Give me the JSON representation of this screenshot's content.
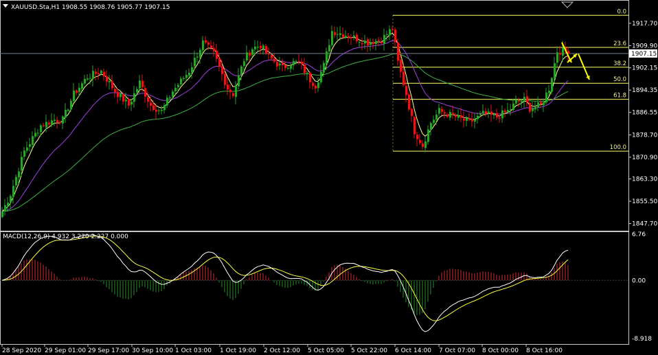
{
  "header": {
    "symbol": "XAUUSD.Sta,H1",
    "ohlc": "1908.55 1908.76 1905.77 1907.15"
  },
  "macd": {
    "label": "MACD(12,26,9) 4.932 3.220 2.227 0.000",
    "axis_ticks": [
      "6.76",
      "0.00",
      "-8.918"
    ]
  },
  "price_axis": {
    "ticks": [
      "1917.70",
      "1909.90",
      "1902.15",
      "1894.35",
      "1886.55",
      "1878.70",
      "1870.90",
      "1863.30",
      "1855.50",
      "1847.70"
    ],
    "current_price": "1907.15"
  },
  "time_axis": {
    "ticks": [
      "28 Sep 2020",
      "29 Sep 01:00",
      "29 Sep 17:00",
      "30 Sep 10:00",
      "1 Oct 03:00",
      "1 Oct 19:00",
      "2 Oct 12:00",
      "5 Oct 05:00",
      "5 Oct 22:00",
      "6 Oct 14:00",
      "7 Oct 07:00",
      "8 Oct 00:00",
      "8 Oct 16:00"
    ]
  },
  "fibonacci": {
    "levels": [
      "0.0",
      "23.6",
      "38.2",
      "50.0",
      "61.8",
      "100.0"
    ],
    "high_price": 1920.5,
    "low_price": 1873.0,
    "color": "#ffff66"
  },
  "colors": {
    "bull": "#2ea02e",
    "bear": "#e01818",
    "ema_fast": "#ffff9a",
    "ema_mid": "#a040e0",
    "ema_slow": "#3cb043",
    "macd_line": "#ffffff",
    "signal_line": "#ffff40",
    "hist_pos": "#d03030",
    "hist_neg": "#2e8b2e",
    "arrow": "#ffff00"
  },
  "chart_data": {
    "type": "candlestick",
    "timeframe": "H1",
    "price_range": [
      1845.2,
      1925.6
    ],
    "anchors": [
      [
        0,
        1852
      ],
      [
        3,
        1858
      ],
      [
        8,
        1873
      ],
      [
        14,
        1882
      ],
      [
        19,
        1884
      ],
      [
        22,
        1884
      ],
      [
        26,
        1893
      ],
      [
        31,
        1899
      ],
      [
        36,
        1901
      ],
      [
        41,
        1894
      ],
      [
        46,
        1889
      ],
      [
        50,
        1897
      ],
      [
        54,
        1889
      ],
      [
        58,
        1887
      ],
      [
        62,
        1894
      ],
      [
        68,
        1901
      ],
      [
        73,
        1911
      ],
      [
        77,
        1907
      ],
      [
        82,
        1895
      ],
      [
        84,
        1893
      ],
      [
        88,
        1905
      ],
      [
        91,
        1909
      ],
      [
        94,
        1910
      ],
      [
        97,
        1906
      ],
      [
        102,
        1902
      ],
      [
        105,
        1904
      ],
      [
        108,
        1904
      ],
      [
        112,
        1898
      ],
      [
        114,
        1896
      ],
      [
        117,
        1903
      ],
      [
        120,
        1915
      ],
      [
        124,
        1914
      ],
      [
        127,
        1913
      ],
      [
        133,
        1911
      ],
      [
        138,
        1912
      ],
      [
        142,
        1916
      ],
      [
        144,
        1904
      ],
      [
        147,
        1893
      ],
      [
        150,
        1880
      ],
      [
        153,
        1875
      ],
      [
        156,
        1883
      ],
      [
        159,
        1887
      ],
      [
        165,
        1885
      ],
      [
        170,
        1883
      ],
      [
        175,
        1886
      ],
      [
        180,
        1885
      ],
      [
        184,
        1887
      ],
      [
        187,
        1890
      ],
      [
        190,
        1891
      ],
      [
        192,
        1888
      ],
      [
        196,
        1889
      ],
      [
        199,
        1895
      ],
      [
        202,
        1908
      ],
      [
        205,
        1908
      ],
      [
        206,
        1907.15
      ]
    ],
    "forecast_arrows": [
      [
        1911,
        1904
      ],
      [
        1904,
        1907
      ],
      [
        1907,
        1898
      ]
    ]
  }
}
